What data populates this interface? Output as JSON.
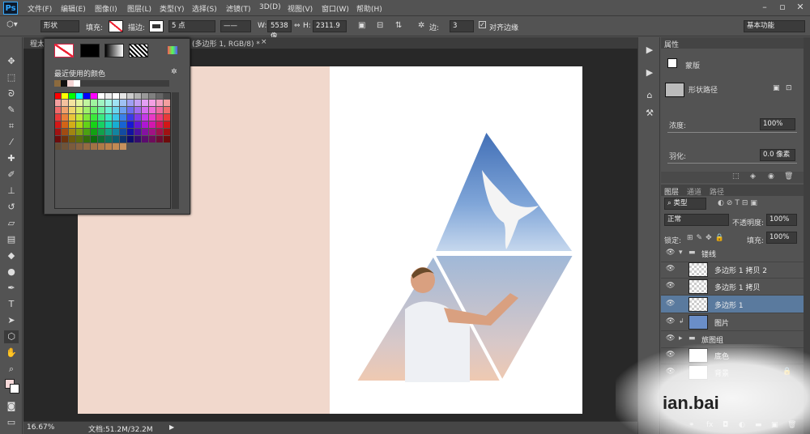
{
  "app": {
    "logo": "Ps"
  },
  "menu": [
    "文件(F)",
    "编辑(E)",
    "图像(I)",
    "图层(L)",
    "类型(Y)",
    "选择(S)",
    "滤镜(T)",
    "3D(D)",
    "视图(V)",
    "窗口(W)",
    "帮助(H)"
  ],
  "options": {
    "shape_mode": "形状",
    "fill_label": "填充:",
    "stroke_label": "描边:",
    "stroke_size": "5 点",
    "w_label": "W:",
    "w_value": "5538 像",
    "h_label": "H:",
    "h_value": "2311.9",
    "sides_label": "边:",
    "sides_value": "3",
    "align_label": "对齐边缘",
    "workspace": "基本功能"
  },
  "tab": {
    "title": "程太",
    "doc_title": "(多边形 1, RGB/8) *"
  },
  "swatches": {
    "recent_label": "最近使用的颜色"
  },
  "status": {
    "zoom": "16.67%",
    "doc": "文档:51.2M/32.2M"
  },
  "properties": {
    "tab": "属性",
    "mask_label": "蒙版",
    "shape_path": "形状路径",
    "density_label": "浓度:",
    "density_value": "100%",
    "feather_label": "羽化:",
    "feather_value": "0.0 像素"
  },
  "layers": {
    "tabs": [
      "图层",
      "通道",
      "路径"
    ],
    "filter": "类型",
    "blend": "正常",
    "opacity_label": "不透明度:",
    "opacity_value": "100%",
    "lock_label": "锁定:",
    "fill_label": "填充:",
    "fill_value": "100%",
    "items": [
      {
        "name": "镂线",
        "type": "group"
      },
      {
        "name": "多边形 1 拷贝 2",
        "type": "shape"
      },
      {
        "name": "多边形 1 拷贝",
        "type": "shape"
      },
      {
        "name": "多边形 1",
        "type": "shape",
        "selected": true
      },
      {
        "name": "图片",
        "type": "image"
      },
      {
        "name": "旅图组",
        "type": "group"
      },
      {
        "name": "底色",
        "type": "fill"
      },
      {
        "name": "背景",
        "type": "bg"
      }
    ]
  },
  "watermark": "ian.bai",
  "colors": {
    "ui_bg": "#535353",
    "dark": "#282828",
    "selected": "#5a7a9e",
    "peach": "#f1d8cc",
    "accent": "#31a8ff"
  }
}
